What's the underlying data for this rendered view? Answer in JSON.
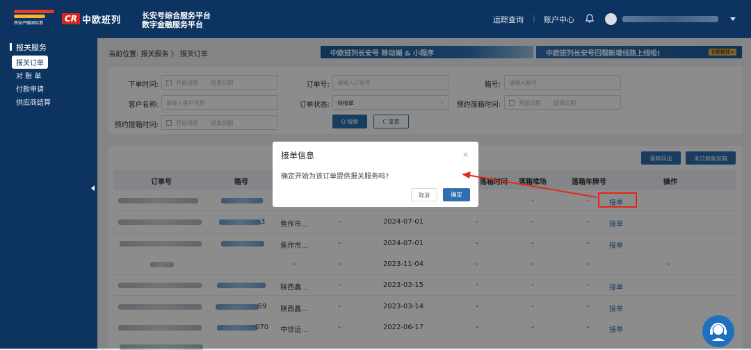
{
  "header": {
    "logo_text": "西安产融国际港",
    "cr_brand": "CR",
    "cr_name": "中欧班列",
    "platform_line1": "长安号综合服务平台",
    "platform_line2": "数字金融服务平台",
    "nav": [
      "运踪查询",
      "账户中心"
    ]
  },
  "sidebar": {
    "section": "报关服务",
    "items": [
      {
        "label": "报关订单",
        "active": true
      },
      {
        "label": "对 账 单",
        "active": false
      },
      {
        "label": "付款申请",
        "active": false
      },
      {
        "label": "供应商结算",
        "active": false
      }
    ]
  },
  "breadcrumb": "当前位置: 报关服务 〉 报关订单",
  "banners": {
    "banner1": "中欧班列长安号 移动端 & 小程序",
    "banner2": "中欧班列长安号回程新增线路上线啦!",
    "banner2_tag": "立即前往>"
  },
  "filters": {
    "order_time_label": "下单时间:",
    "customer_label": "客户名称:",
    "pickup_time_label": "预约提箱时间:",
    "order_no_label": "订单号:",
    "order_status_label": "订单状态:",
    "box_no_label": "箱号:",
    "drop_time_label": "预约落箱时间:",
    "start_date": "开始日期",
    "end_date": "结束日期",
    "range_sep": "-",
    "customer_placeholder": "请输入客户名称",
    "order_no_placeholder": "请输入订单号",
    "box_no_placeholder": "请输入箱号",
    "order_status_value": "待接单",
    "search_btn": "Q 搜索",
    "reset_btn": "C 重置"
  },
  "table_buttons": {
    "export": "落箱导出",
    "unordered": "未订舱集装箱"
  },
  "table": {
    "headers": [
      "订单号",
      "箱号",
      "落箱时间",
      "落箱堆场",
      "落箱车牌号",
      "操作"
    ],
    "rows": [
      {
        "city": "",
        "c3": "",
        "date": "",
        "c5": "-",
        "c6": "-",
        "c7": "-",
        "action": "接单"
      },
      {
        "city": "焦作市...",
        "c3": "-",
        "date": "2024-07-01",
        "c5": "-",
        "c6": "-",
        "c7": "-",
        "action": "接单"
      },
      {
        "city": "焦作市...",
        "c3": "-",
        "date": "2024-07-01",
        "c5": "-",
        "c6": "-",
        "c7": "-",
        "action": "接单"
      },
      {
        "city": "-",
        "c3": "-",
        "date": "2023-11-04",
        "c5": "-",
        "c6": "-",
        "c7": "-",
        "action": "-"
      },
      {
        "city": "陕西鑫...",
        "c3": "-",
        "date": "2023-03-15",
        "c5": "-",
        "c6": "-",
        "c7": "-",
        "action": "接单"
      },
      {
        "city": "陕西鑫...",
        "c3": "-",
        "date": "2023-03-14",
        "c5": "-",
        "c6": "-",
        "c7": "-",
        "action": "接单"
      },
      {
        "city": "中世运...",
        "c3": "-",
        "date": "2022-06-17",
        "c5": "-",
        "c6": "-",
        "c7": "-",
        "action": "接单"
      }
    ],
    "box_suffix": [
      "",
      "3",
      "",
      "",
      "",
      "59",
      "070"
    ]
  },
  "modal": {
    "title": "接单信息",
    "close": "×",
    "message": "确定开始为该订单提供报关服务吗?",
    "cancel": "取消",
    "ok": "确定"
  },
  "colors": {
    "nav_bg": "#0d3460",
    "primary": "#2f6fb0",
    "highlight": "#e8251a"
  }
}
